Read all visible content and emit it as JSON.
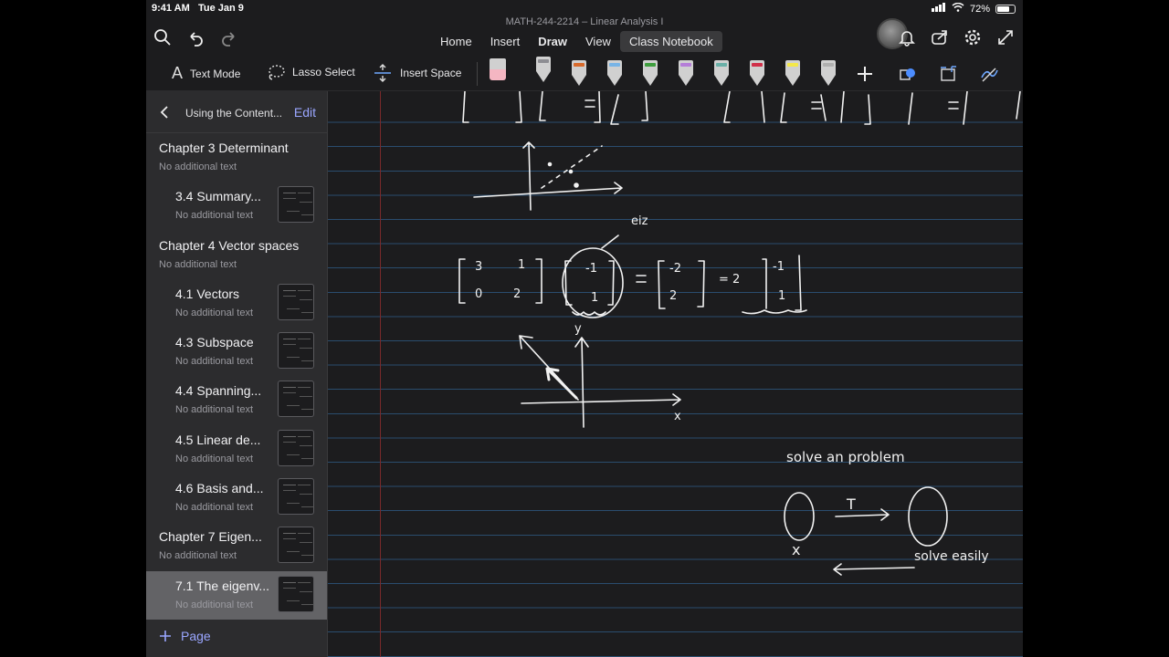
{
  "status": {
    "time": "9:41 AM",
    "date": "Tue Jan 9",
    "battery": "72%",
    "battery_level": 0.72
  },
  "document_title": "MATH-244-2214 – Linear Analysis I",
  "header": {
    "tabs": [
      {
        "label": "Home"
      },
      {
        "label": "Insert"
      },
      {
        "label": "Draw"
      },
      {
        "label": "View"
      },
      {
        "label": "Class Notebook"
      }
    ],
    "active_tab": "Draw",
    "icons": [
      "search-icon",
      "undo-icon",
      "redo-icon",
      "bell-icon",
      "share-icon",
      "gear-icon",
      "expand-icon"
    ]
  },
  "draw_toolbar": {
    "text_mode": "Text Mode",
    "lasso_select": "Lasso Select",
    "insert_space": "Insert Space",
    "pen_colors": [
      "#f4b6c2",
      "#8e8e93",
      "#d86a2c",
      "#78b4e6",
      "#3f9e3f",
      "#b57ed8",
      "#6ab0a8",
      "#d0304a",
      "#f4e84a",
      "#b0b0b0"
    ]
  },
  "sidebar": {
    "back_label": "Using the Content...",
    "edit_label": "Edit",
    "add_page_label": "Page",
    "items": [
      {
        "name": "Chapter 3 Determinant",
        "sub": "No additional text",
        "section": true
      },
      {
        "name": "3.4 Summary...",
        "sub": "No additional text",
        "section": false
      },
      {
        "name": "Chapter 4 Vector spaces",
        "sub": "No additional text",
        "section": true
      },
      {
        "name": "4.1 Vectors",
        "sub": "No additional text",
        "section": false
      },
      {
        "name": "4.3 Subspace",
        "sub": "No additional text",
        "section": false
      },
      {
        "name": "4.4 Spanning...",
        "sub": "No additional text",
        "section": false
      },
      {
        "name": "4.5 Linear de...",
        "sub": "No additional text",
        "section": false
      },
      {
        "name": "4.6 Basis and...",
        "sub": "No additional text",
        "section": false
      },
      {
        "name": "Chapter 7 Eigen...",
        "sub": "No additional text",
        "section": true
      },
      {
        "name": "7.1 The eigenv...",
        "sub": "No additional text",
        "section": false,
        "selected": true
      }
    ]
  },
  "notes": {
    "annotation_eig": "eiz",
    "matrix_row1": [
      "3",
      "1"
    ],
    "matrix_row2": [
      "0",
      "2"
    ],
    "vector_top": "-1",
    "vector_bottom": "1",
    "result_top": "-2",
    "result_bottom": "2",
    "scalar": "= 2",
    "axis_y": "y",
    "axis_x": "x",
    "solve_a_problem": "solve an problem",
    "map_label": "T",
    "domain_label": "x",
    "solve_easily": "solve easily"
  }
}
